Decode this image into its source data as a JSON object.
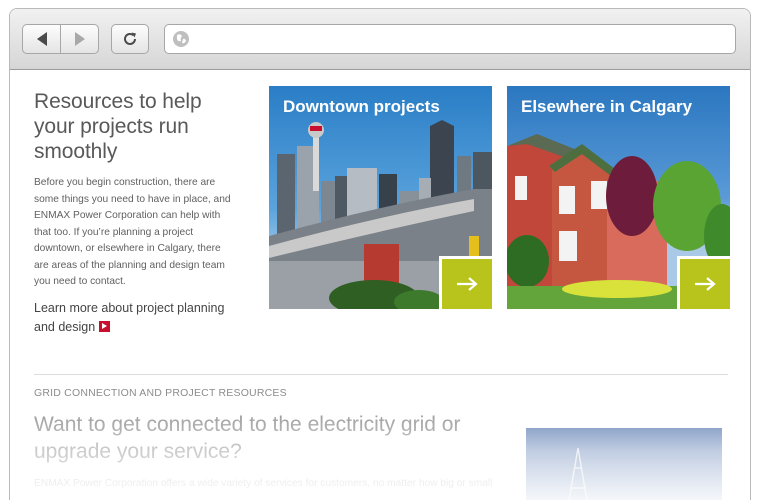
{
  "browser": {
    "address_value": "",
    "buttons": {
      "back": "back-arrow-icon",
      "forward": "forward-arrow-icon",
      "reload": "reload-icon",
      "site": "globe-icon"
    }
  },
  "intro": {
    "heading": "Resources to help your projects run smoothly",
    "body": "Before you begin construction, there are some things you need to have in place, and ENMAX Power Corporation can help with that too. If you’re planning a project downtown, or elsewhere in Calgary, there are areas of the planning and design team you need to contact.",
    "link_label": "Learn more about project planning and design"
  },
  "cards": [
    {
      "title": "Downtown projects",
      "button_icon": "arrow-right-icon"
    },
    {
      "title": "Elsewhere in Calgary",
      "button_icon": "arrow-right-icon"
    }
  ],
  "grid_section": {
    "label": "GRID CONNECTION AND PROJECT RESOURCES",
    "heading": "Want to get connected to the electricity grid or upgrade your service?",
    "body": "ENMAX Power Corporation offers a wide variety of services for customers, no matter how big or small"
  },
  "colors": {
    "accent_green": "#b8c41b",
    "accent_red": "#c8102e",
    "heading_gray": "#595959"
  }
}
